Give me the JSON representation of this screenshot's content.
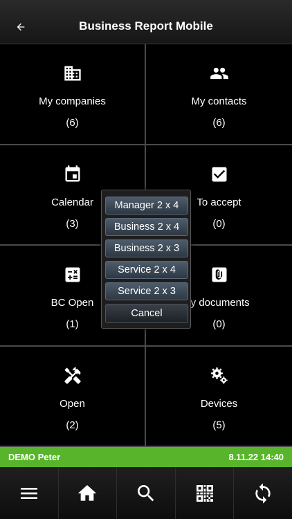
{
  "header": {
    "title": "Business Report Mobile",
    "back_icon": "arrow-left-icon"
  },
  "tiles": [
    {
      "label": "My companies",
      "count": "(6)",
      "icon": "building-icon"
    },
    {
      "label": "My contacts",
      "count": "(6)",
      "icon": "people-icon"
    },
    {
      "label": "Calendar",
      "count": "(3)",
      "icon": "calendar-icon"
    },
    {
      "label": "To accept",
      "count": "(0)",
      "icon": "checkbox-icon"
    },
    {
      "label": "BC Open",
      "count": "(1)",
      "icon": "calculator-icon"
    },
    {
      "label": "ly documents",
      "count": "(0)",
      "icon": "attachment-icon"
    },
    {
      "label": "Open",
      "count": "(2)",
      "icon": "tools-icon"
    },
    {
      "label": "Devices",
      "count": "(5)",
      "icon": "gears-icon"
    }
  ],
  "status": {
    "user": "DEMO Peter",
    "datetime": "8.11.22 14:40",
    "color": "#58b52b"
  },
  "bottom_nav": [
    {
      "icon": "menu-icon"
    },
    {
      "icon": "home-icon"
    },
    {
      "icon": "search-icon"
    },
    {
      "icon": "qr-code-icon"
    },
    {
      "icon": "sync-icon"
    }
  ],
  "popup": {
    "items": [
      "Manager 2 x 4",
      "Business 2 x 4",
      "Business 2 x 3",
      "Service 2 x 4",
      "Service 2 x 3"
    ],
    "cancel_label": "Cancel"
  }
}
